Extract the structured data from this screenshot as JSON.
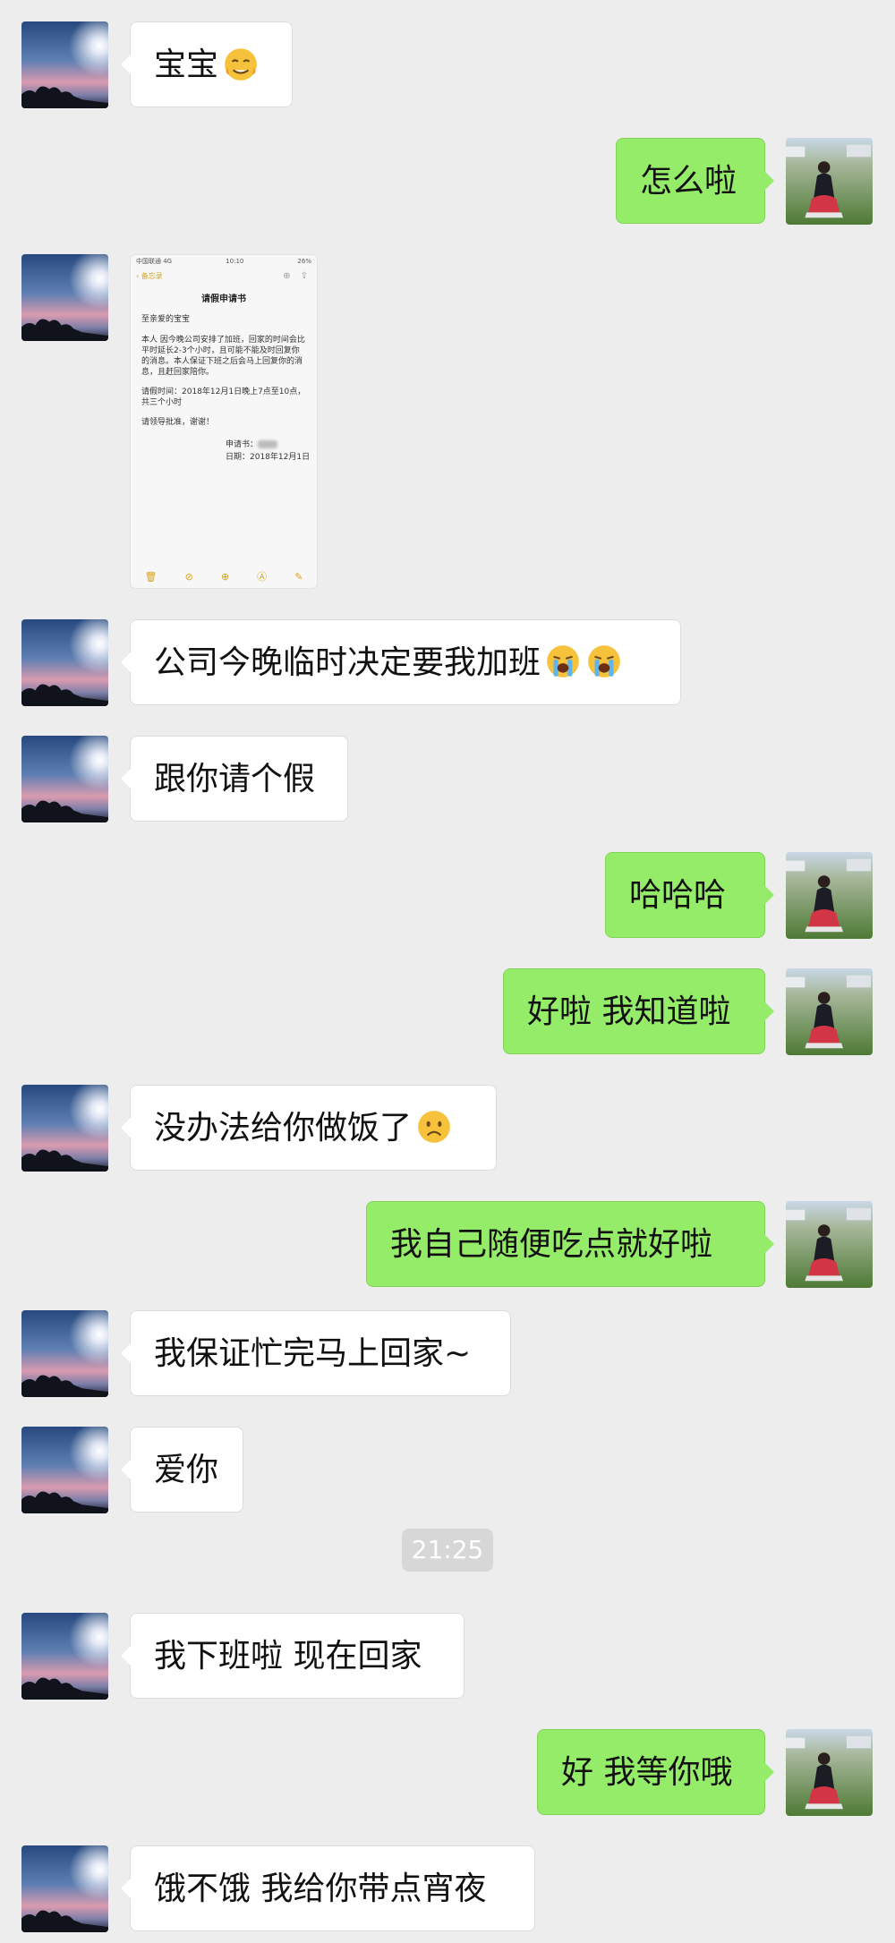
{
  "colors": {
    "background": "#ededed",
    "incoming_bubble": "#ffffff",
    "outgoing_bubble": "#95ec69",
    "timestamp_bg": "#d7d7d7"
  },
  "icons": {
    "contact_avatar": "sunset-sky-avatar",
    "self_avatar": "girl-on-lawn-avatar"
  },
  "messages": [
    {
      "side": "left",
      "text": "宝宝",
      "emoji": "sweat-smile-emoji"
    },
    {
      "side": "right",
      "text": "怎么啦"
    },
    {
      "side": "left",
      "type": "image",
      "image": {
        "carrier": "中国联通  4G",
        "time": "10:10",
        "battery": "26%",
        "back_label": "备忘录",
        "title": "请假申请书",
        "greeting": "至亲爱的宝宝",
        "body": "本人      因今晚公司安排了加班，回家的时间会比平时延长2-3个小时，且可能不能及时回复你的消息。本人保证下班之后会马上回复你的消息，且赶回家陪你。",
        "leave_time": "请假时间：2018年12月1日晚上7点至10点，共三个小时",
        "request": "请领导批准，谢谢！",
        "applicant": "申请书：",
        "date": "日期：2018年12月1日"
      }
    },
    {
      "side": "left",
      "text": "公司今晚临时决定要我加班",
      "emoji": "loudly-crying-emoji",
      "emoji_count": 2
    },
    {
      "side": "left",
      "text": "跟你请个假"
    },
    {
      "side": "right",
      "text": "哈哈哈"
    },
    {
      "side": "right",
      "text": "好啦 我知道啦"
    },
    {
      "side": "left",
      "text": "没办法给你做饭了",
      "emoji": "frowning-face-emoji"
    },
    {
      "side": "right",
      "text": "我自己随便吃点就好啦"
    },
    {
      "side": "left",
      "text": "我保证忙完马上回家~"
    },
    {
      "side": "left",
      "text": "爱你"
    },
    {
      "side": "left",
      "text": "我下班啦 现在回家"
    },
    {
      "side": "right",
      "text": "好 我等你哦"
    },
    {
      "side": "left",
      "text": "饿不饿 我给你带点宵夜"
    }
  ],
  "timestamp": "21:25"
}
